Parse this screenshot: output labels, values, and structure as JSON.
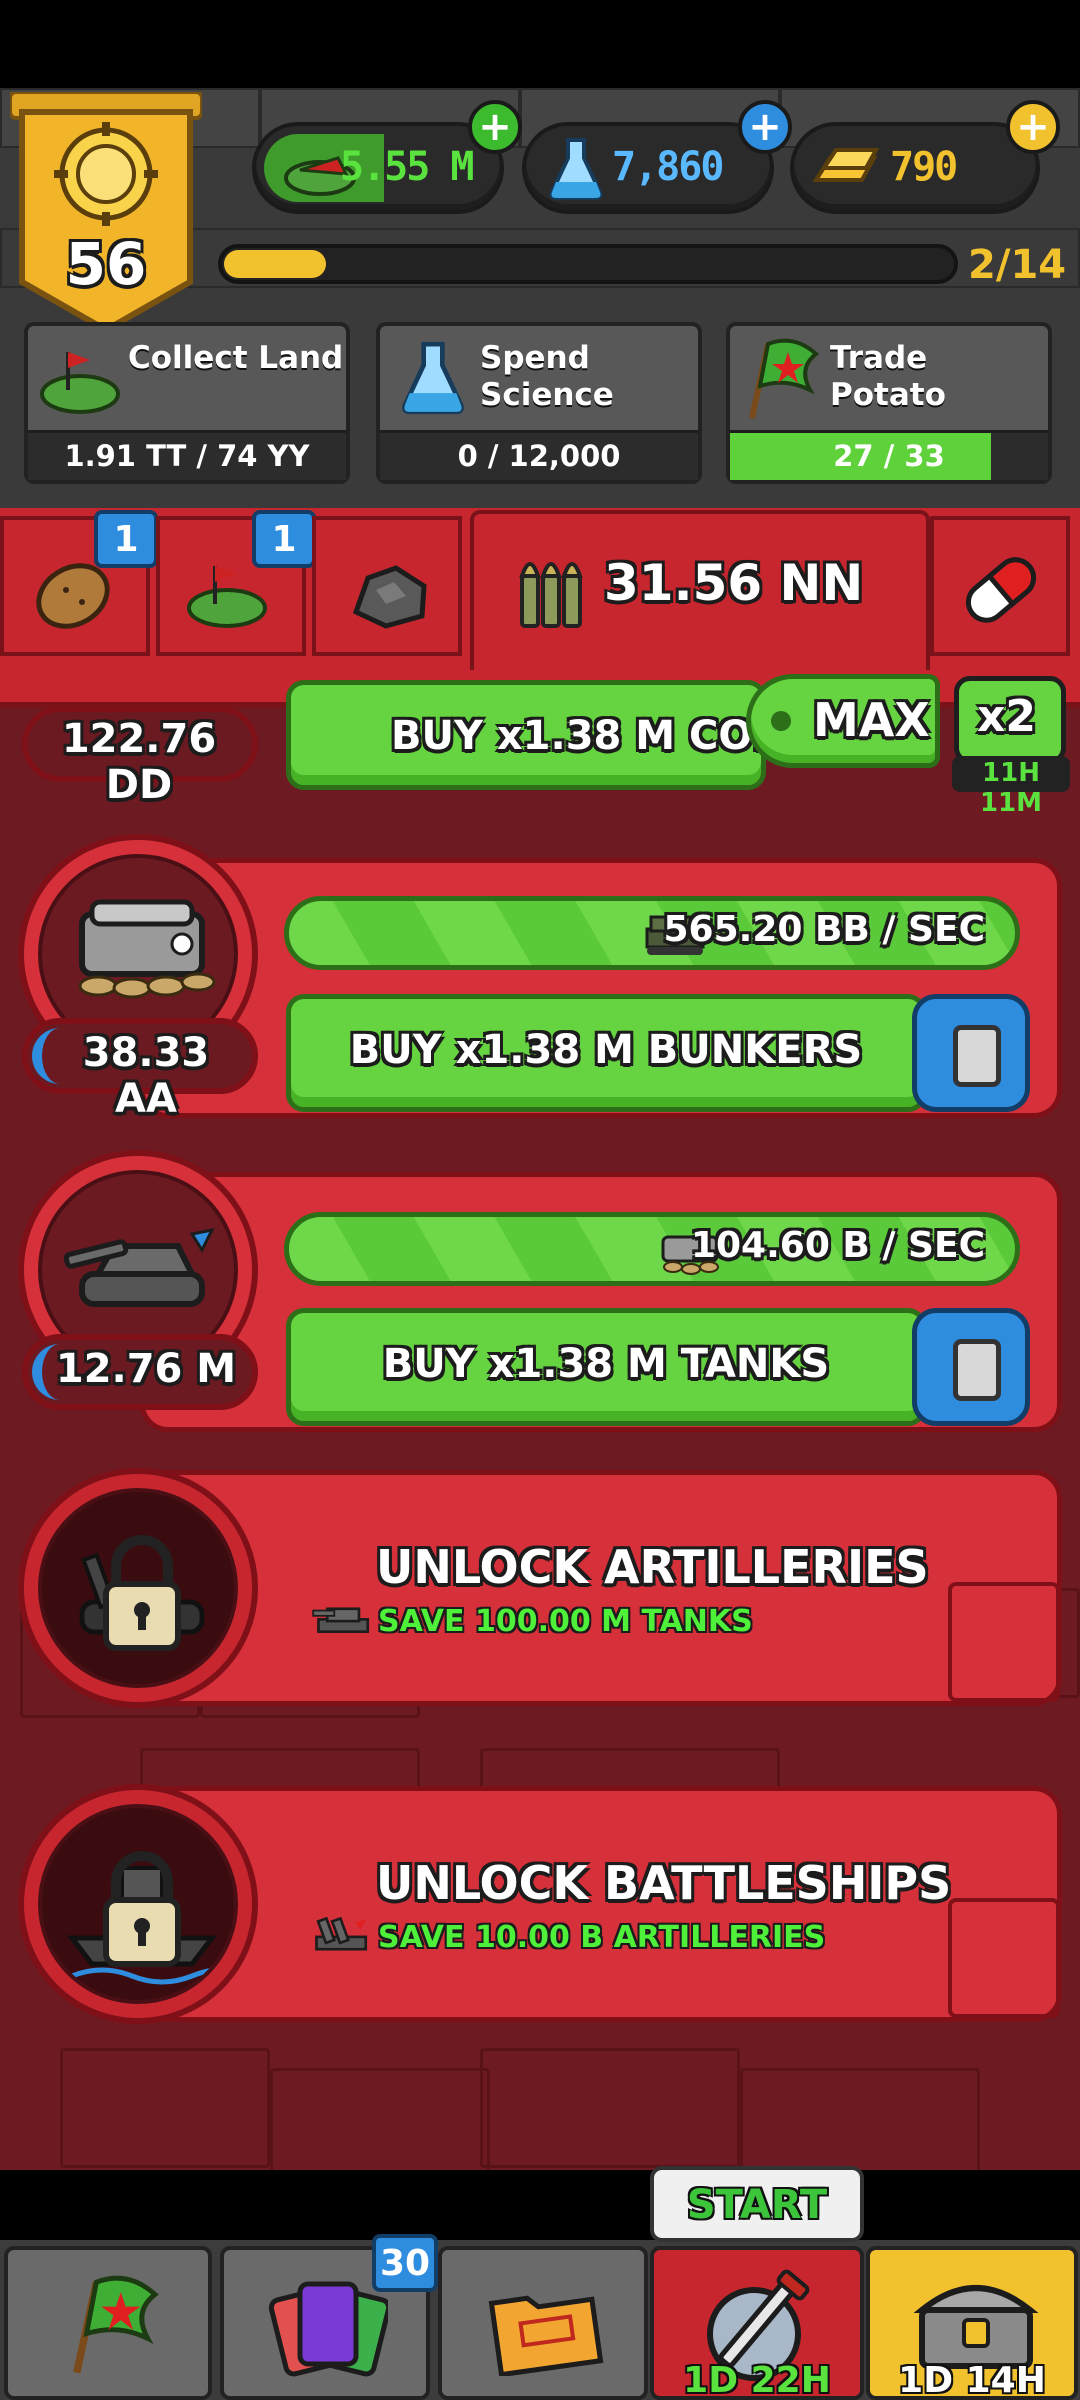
{
  "player": {
    "level": "56",
    "xp_progress": "2/14",
    "xp_fraction": 0.14
  },
  "resources": {
    "land": {
      "value": "5.55 M",
      "icon": "land-icon"
    },
    "science": {
      "value": "7,860",
      "icon": "flask-icon"
    },
    "gold": {
      "value": "790",
      "icon": "gold-bar-icon"
    }
  },
  "missions": [
    {
      "title": "Collect Land",
      "progress": "1.91 TT / 74 YY",
      "fraction": 0.0
    },
    {
      "title": "Spend\nScience",
      "progress": "0 / 12,000",
      "fraction": 0.0
    },
    {
      "title": "Trade Potato",
      "progress": "27 / 33",
      "fraction": 0.82
    }
  ],
  "tabs": {
    "potato_badge": "1",
    "land_badge": "1",
    "ammo_value": "31.56 NN"
  },
  "top_row": {
    "count": "122.76 DD",
    "buy_label": "BUY x1.38 M COM",
    "max_label": "MAX",
    "boost_label": "x2",
    "boost_timer": "11H 11M"
  },
  "units": [
    {
      "name": "bunkers",
      "count": "38.33 AA",
      "count_fraction": 0.3,
      "rate": "565.20 BB / SEC",
      "buy_label": "BUY x1.38 M BUNKERS"
    },
    {
      "name": "tanks",
      "count": "12.76 M",
      "count_fraction": 0.1,
      "rate": "104.60 B / SEC",
      "buy_label": "BUY x1.38 M TANKS"
    }
  ],
  "locked": [
    {
      "title": "UNLOCK ARTILLERIES",
      "requirement": "SAVE 100.00 M TANKS"
    },
    {
      "title": "UNLOCK BATTLESHIPS",
      "requirement": "SAVE 10.00 B ARTILLERIES"
    }
  ],
  "bottom_nav": {
    "cards_badge": "30",
    "event_start": "START",
    "event_timer": "1D 22H",
    "chest_timer": "1D 14H"
  },
  "colors": {
    "accent_green": "#66d440",
    "panel_red": "#d6303a",
    "badge_blue": "#2f8de0",
    "gold": "#f2c12e"
  }
}
